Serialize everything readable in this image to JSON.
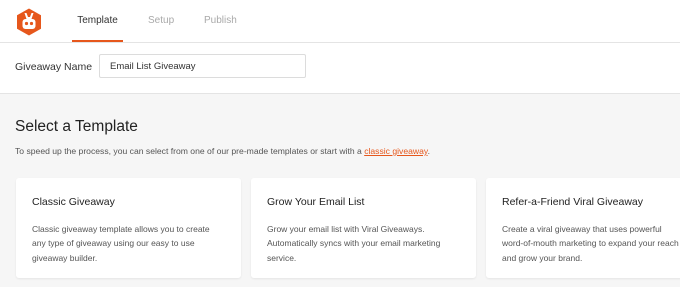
{
  "brand": {
    "accent": "#e6571c",
    "logo_icon": "rabbit-robot-icon"
  },
  "tabs": [
    {
      "label": "Template",
      "active": true
    },
    {
      "label": "Setup",
      "active": false
    },
    {
      "label": "Publish",
      "active": false
    }
  ],
  "giveaway_name": {
    "label": "Giveaway Name",
    "value": "Email List Giveaway"
  },
  "main": {
    "title": "Select a Template",
    "intro_text": "To speed up the process, you can select from one of our pre-made templates or start with a",
    "intro_link": "classic giveaway",
    "intro_end": "."
  },
  "templates": [
    {
      "title": "Classic Giveaway",
      "description": "Classic giveaway template allows you to create any type of giveaway using our easy to use giveaway builder."
    },
    {
      "title": "Grow Your Email List",
      "description": "Grow your email list with Viral Giveaways. Automatically syncs with your email marketing service."
    },
    {
      "title": "Refer-a-Friend Viral Giveaway",
      "description": "Create a viral giveaway that uses powerful word-of-mouth marketing to expand your reach and grow your brand."
    }
  ]
}
